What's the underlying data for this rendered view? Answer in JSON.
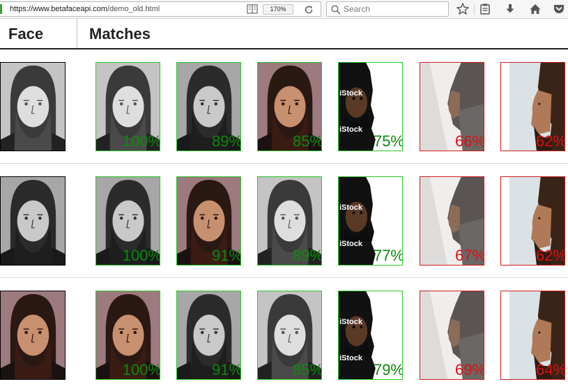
{
  "browser": {
    "url_host": "https://www.betafaceapi.com",
    "url_path": "/demo_old.html",
    "zoom": "170%",
    "search_placeholder": "Search"
  },
  "page": {
    "face_header": "Face",
    "matches_header": "Matches"
  },
  "watermark": "iStock",
  "rows": [
    {
      "face": "man-gray-light",
      "matches": [
        {
          "img": "man-gray-light",
          "pct": "100%",
          "status": "match"
        },
        {
          "img": "man-gray-dark",
          "pct": "89%",
          "status": "match"
        },
        {
          "img": "man-color",
          "pct": "85%",
          "status": "match"
        },
        {
          "img": "istock-black",
          "pct": "75%",
          "status": "match"
        },
        {
          "img": "profile-gray",
          "pct": "66%",
          "status": "no-match"
        },
        {
          "img": "profile-brown",
          "pct": "62%",
          "status": "no-match"
        }
      ]
    },
    {
      "face": "man-gray-dark",
      "matches": [
        {
          "img": "man-gray-dark",
          "pct": "100%",
          "status": "match"
        },
        {
          "img": "man-color",
          "pct": "91%",
          "status": "match"
        },
        {
          "img": "man-gray-light",
          "pct": "89%",
          "status": "match"
        },
        {
          "img": "istock-black",
          "pct": "77%",
          "status": "match"
        },
        {
          "img": "profile-gray",
          "pct": "67%",
          "status": "no-match"
        },
        {
          "img": "profile-brown",
          "pct": "62%",
          "status": "no-match"
        }
      ]
    },
    {
      "face": "man-color",
      "matches": [
        {
          "img": "man-color",
          "pct": "100%",
          "status": "match"
        },
        {
          "img": "man-gray-dark",
          "pct": "91%",
          "status": "match"
        },
        {
          "img": "man-gray-light",
          "pct": "85%",
          "status": "match"
        },
        {
          "img": "istock-black",
          "pct": "79%",
          "status": "match"
        },
        {
          "img": "profile-gray",
          "pct": "69%",
          "status": "no-match"
        },
        {
          "img": "profile-brown",
          "pct": "64%",
          "status": "no-match"
        }
      ]
    }
  ],
  "colors": {
    "match": "#0c8a0c",
    "no_match": "#dd1010"
  },
  "icons": [
    "reader-view-icon",
    "reload-icon",
    "search-icon",
    "bookmark-star-icon",
    "reading-list-icon",
    "download-icon",
    "home-icon",
    "pocket-icon"
  ]
}
